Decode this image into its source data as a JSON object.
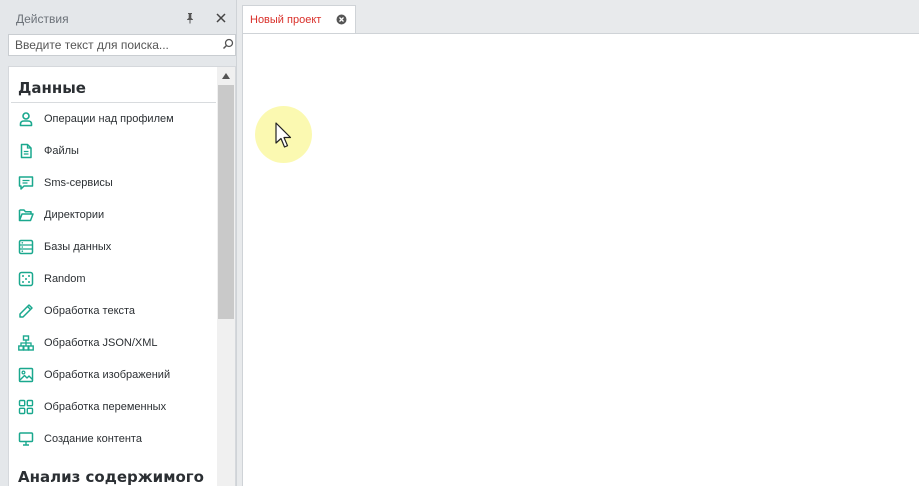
{
  "panel": {
    "title": "Действия",
    "search_placeholder": "Введите текст для поиска...",
    "groups": [
      {
        "title": "Данные",
        "items": [
          {
            "label": "Операции над профилем",
            "icon": "user-icon"
          },
          {
            "label": "Файлы",
            "icon": "file-icon"
          },
          {
            "label": "Sms-сервисы",
            "icon": "message-icon"
          },
          {
            "label": "Директории",
            "icon": "folder-icon"
          },
          {
            "label": "Базы данных",
            "icon": "database-icon"
          },
          {
            "label": "Random",
            "icon": "dice-icon"
          },
          {
            "label": "Обработка текста",
            "icon": "pencil-icon"
          },
          {
            "label": "Обработка JSON/XML",
            "icon": "hierarchy-icon"
          },
          {
            "label": "Обработка изображений",
            "icon": "image-icon"
          },
          {
            "label": "Обработка переменных",
            "icon": "grid-icon"
          },
          {
            "label": "Создание контента",
            "icon": "monitor-icon"
          }
        ]
      },
      {
        "title": "Анализ содержимого",
        "items": []
      }
    ]
  },
  "tabs": [
    {
      "label": "Новый проект",
      "active": true
    }
  ],
  "colors": {
    "accent": "#1aa88e",
    "tab_text": "#d9302a",
    "cursor_highlight": "#fbf8a8"
  }
}
